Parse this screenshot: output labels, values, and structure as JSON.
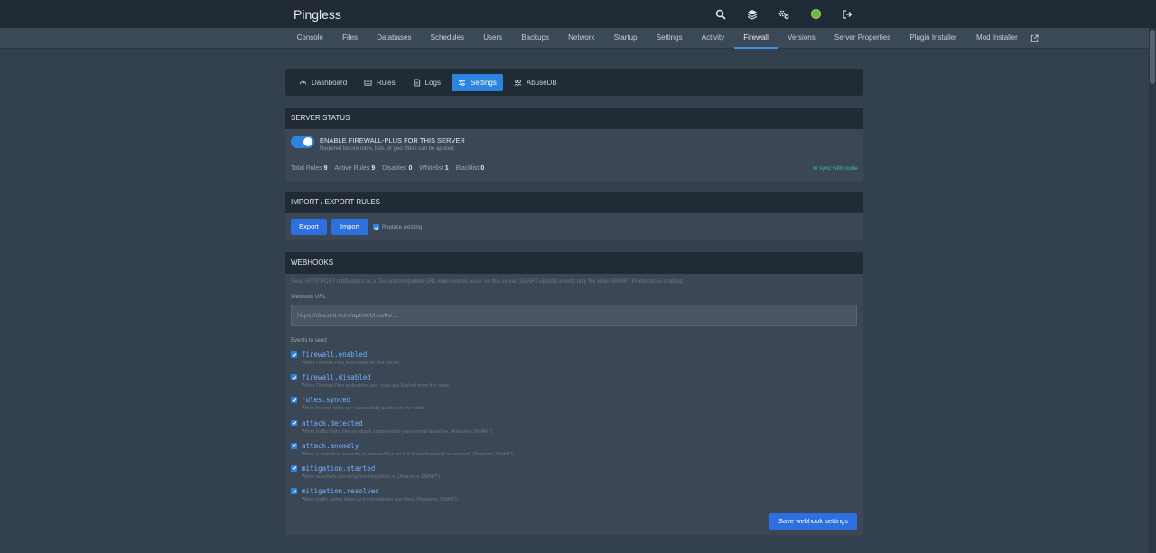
{
  "app": {
    "title": "Pingless"
  },
  "top_icons": [
    "search-icon",
    "layers-icon",
    "settings-cogs-icon",
    "avatar-icon",
    "logout-icon"
  ],
  "nav": {
    "items": [
      "Console",
      "Files",
      "Databases",
      "Schedules",
      "Users",
      "Backups",
      "Network",
      "Startup",
      "Settings",
      "Activity",
      "Firewall",
      "Versions",
      "Server Properties",
      "Plugin Installer",
      "Mod Installer"
    ],
    "active": "Firewall"
  },
  "subtabs": {
    "items": [
      "Dashboard",
      "Rules",
      "Logs",
      "Settings",
      "AbuseDB"
    ],
    "icons": [
      "gauge-icon",
      "rules-icon",
      "logs-icon",
      "sliders-icon",
      "users-icon"
    ],
    "active": "Settings"
  },
  "server_status": {
    "header": "SERVER STATUS",
    "toggle_title": "ENABLE FIREWALL-PLUS FOR THIS SERVER",
    "toggle_sub": "Required before rules, lists, or geo filters can be applied.",
    "toggle_on": true,
    "stats": [
      {
        "label": "Total Rules",
        "value": "9"
      },
      {
        "label": "Active Rules",
        "value": "9"
      },
      {
        "label": "Disabled",
        "value": "0"
      },
      {
        "label": "Whitelist",
        "value": "1"
      },
      {
        "label": "Blacklist",
        "value": "0"
      }
    ],
    "sync_status": "In sync with node"
  },
  "import_export": {
    "header": "IMPORT / EXPORT RULES",
    "export_label": "Export",
    "import_label": "Import",
    "replace_label": "Replace existing",
    "replace_checked": true
  },
  "webhooks": {
    "header": "WEBHOOKS",
    "description": "Send HTTP POST notifications to a Discord-compatible URL when events occur on this server. SMART-specific events only fire when SMART Protection is enabled.",
    "url_label": "Webhook URL",
    "url_placeholder": "https://discord.com/api/webhooks/...",
    "events_label": "Events to send",
    "events": [
      {
        "name": "firewall.enabled",
        "desc": "When Firewall Plus is enabled on this server.",
        "checked": true
      },
      {
        "name": "firewall.disabled",
        "desc": "When Firewall Plus is disabled and rules are flushed from the node.",
        "checked": true
      },
      {
        "name": "rules.synced",
        "desc": "When firewall rules are successfully pushed to the node.",
        "checked": true
      },
      {
        "name": "attack.detected",
        "desc": "When traffic looks like an attack compared to your normal baseline. (Requires SMART)",
        "checked": true
      },
      {
        "name": "attack.anomaly",
        "desc": "When a statistical anomaly is detected but no full attack threshold is reached. (Requires SMART)",
        "checked": true
      },
      {
        "name": "mitigation.started",
        "desc": "When automatic blocking/throttling kicks in. (Requires SMART)",
        "checked": true
      },
      {
        "name": "mitigation.resolved",
        "desc": "When traffic calms down and extra blocks are lifted. (Requires SMART)",
        "checked": true
      }
    ],
    "save_label": "Save webhook settings"
  },
  "colors": {
    "accent": "#2b84e0",
    "button": "#2b6fe0",
    "sync": "#33c28c",
    "event_name": "#6fb2ff"
  }
}
